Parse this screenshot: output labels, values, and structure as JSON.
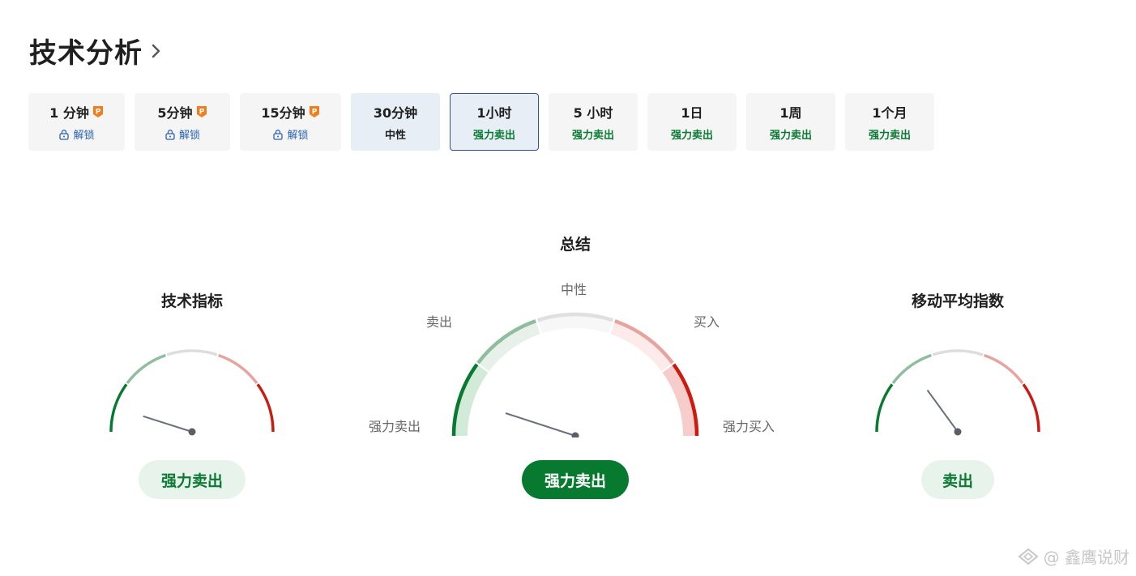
{
  "header": {
    "title": "技术分析",
    "chevron_icon": "chevron-right-icon"
  },
  "tabs": [
    {
      "label": "1 分钟",
      "status": "解锁",
      "locked": true
    },
    {
      "label": "5分钟",
      "status": "解锁",
      "locked": true
    },
    {
      "label": "15分钟",
      "status": "解锁",
      "locked": true
    },
    {
      "label": "30分钟",
      "status": "中性",
      "locked": false
    },
    {
      "label": "1小时",
      "status": "强力卖出",
      "locked": false,
      "selected": true
    },
    {
      "label": "5 小时",
      "status": "强力卖出",
      "locked": false
    },
    {
      "label": "1日",
      "status": "强力卖出",
      "locked": false
    },
    {
      "label": "1周",
      "status": "强力卖出",
      "locked": false
    },
    {
      "label": "1个月",
      "status": "强力卖出",
      "locked": false
    }
  ],
  "summary": {
    "title": "总结",
    "labels": {
      "strong_sell": "强力卖出",
      "sell": "卖出",
      "neutral": "中性",
      "buy": "买入",
      "strong_buy": "强力买入"
    },
    "verdict": "强力卖出"
  },
  "technical_indicators": {
    "title": "技术指标",
    "verdict": "强力卖出"
  },
  "moving_averages": {
    "title": "移动平均指数",
    "verdict": "卖出"
  },
  "colors": {
    "strong_sell": "#087a30",
    "sell": "#8fbd9e",
    "neutral": "#dddddd",
    "buy": "#e7a39d",
    "strong_buy": "#cc1a10",
    "needle": "#6b6f7a"
  },
  "watermark": {
    "text": "@ 鑫鹰说财"
  }
}
